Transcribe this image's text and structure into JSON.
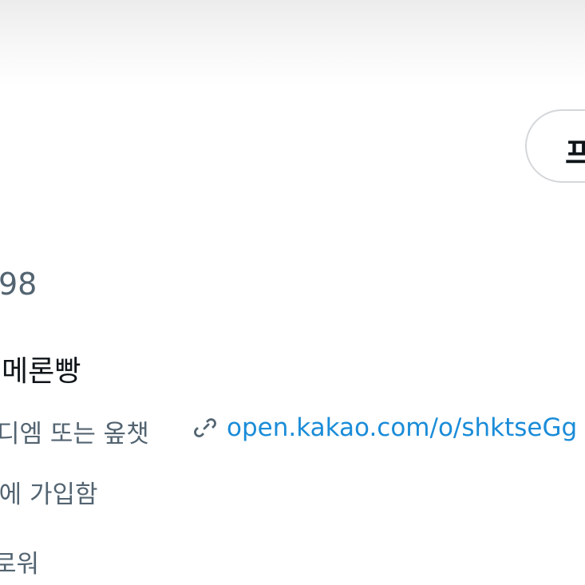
{
  "header": {
    "profile_button_label": "프"
  },
  "profile": {
    "handle_fragment": "98",
    "bio_name": "l메론빵",
    "contact_text": "디엠 또는 옾챗",
    "link_text": "open.kakao.com/o/shktseGg",
    "joined_text": "l에 가입함",
    "follow_fragment": "로워"
  },
  "icons": {
    "link": "link-icon"
  },
  "colors": {
    "link": "#1a8cd8",
    "secondary_text": "#536471",
    "primary_text": "#0f1419",
    "button_border": "#d4d7da"
  }
}
